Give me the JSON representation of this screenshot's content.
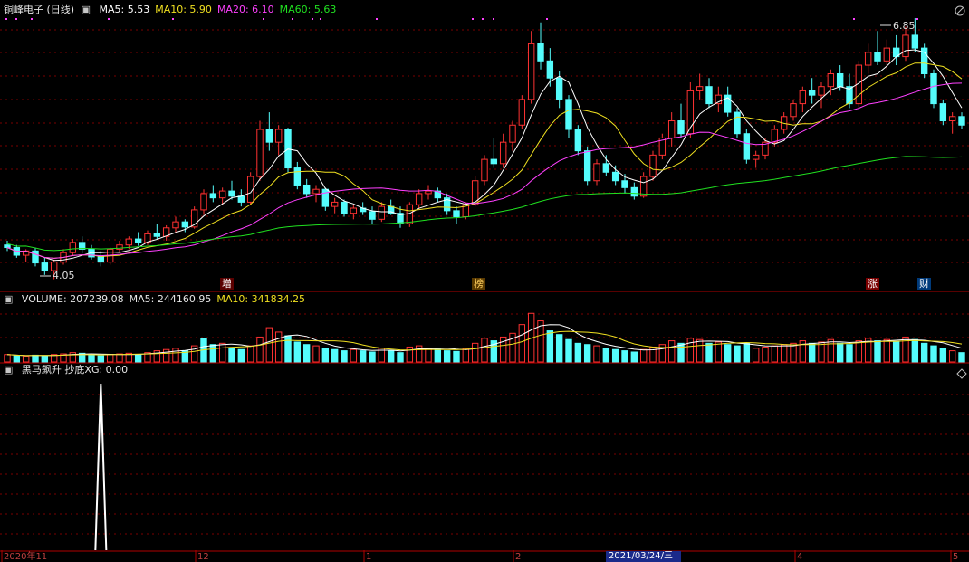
{
  "app": {
    "title": "铜峰电子 (日线)"
  },
  "price_panel": {
    "ma_labels": [
      {
        "text": "MA5: 5.53",
        "color": "#ffffff"
      },
      {
        "text": "MA10: 5.90",
        "color": "#f0e020"
      },
      {
        "text": "MA20: 6.10",
        "color": "#ff40ff"
      },
      {
        "text": "MA60: 5.63",
        "color": "#20e020"
      }
    ],
    "high_label": "6.85",
    "low_label": "4.05",
    "markers": [
      {
        "text": "增",
        "bg": "#5a0000",
        "color": "#ffffff"
      },
      {
        "text": "榜",
        "bg": "#5a3a00",
        "color": "#ffd060"
      },
      {
        "text": "涨",
        "bg": "#7a0000",
        "color": "#ffffff"
      },
      {
        "text": "财",
        "bg": "#003a7a",
        "color": "#ffffff"
      }
    ]
  },
  "volume_panel": {
    "labels": [
      {
        "text": "VOLUME: 207239.08",
        "color": "#e6e6e6"
      },
      {
        "text": "MA5: 244160.95",
        "color": "#e6e6e6"
      },
      {
        "text": "MA10: 341834.25",
        "color": "#f0e020"
      }
    ]
  },
  "indicator_panel": {
    "label": "黑马飙升 抄底XG: 0.00"
  },
  "time_axis": {
    "labels": [
      "2020年11",
      "12",
      "1",
      "2",
      "3",
      "4",
      "5"
    ],
    "cursor_date": "2021/03/24/三"
  },
  "colors": {
    "up": "#ff3232",
    "down": "#54fcfc",
    "grid": "#7a0000",
    "panel_border": "#b00000",
    "ma5": "#ffffff",
    "ma10": "#f0e020",
    "ma20": "#ff40ff",
    "ma60": "#20e020"
  },
  "icons": [
    "window-close-icon",
    "minimize-icon",
    "maximize-icon"
  ],
  "chart_data": {
    "type": "candlestick",
    "price_range": [
      3.95,
      7.1
    ],
    "candles": [
      [
        4.45,
        4.5,
        4.38,
        4.42
      ],
      [
        4.42,
        4.45,
        4.3,
        4.33
      ],
      [
        4.33,
        4.4,
        4.25,
        4.38
      ],
      [
        4.38,
        4.42,
        4.2,
        4.24
      ],
      [
        4.24,
        4.3,
        4.1,
        4.15
      ],
      [
        4.15,
        4.28,
        4.05,
        4.25
      ],
      [
        4.25,
        4.4,
        4.22,
        4.36
      ],
      [
        4.36,
        4.52,
        4.32,
        4.48
      ],
      [
        4.48,
        4.55,
        4.35,
        4.4
      ],
      [
        4.4,
        4.45,
        4.28,
        4.31
      ],
      [
        4.31,
        4.38,
        4.2,
        4.25
      ],
      [
        4.25,
        4.42,
        4.22,
        4.4
      ],
      [
        4.4,
        4.5,
        4.36,
        4.45
      ],
      [
        4.45,
        4.55,
        4.4,
        4.52
      ],
      [
        4.52,
        4.6,
        4.44,
        4.48
      ],
      [
        4.48,
        4.62,
        4.45,
        4.58
      ],
      [
        4.58,
        4.7,
        4.52,
        4.55
      ],
      [
        4.55,
        4.68,
        4.5,
        4.65
      ],
      [
        4.65,
        4.78,
        4.6,
        4.72
      ],
      [
        4.72,
        4.75,
        4.6,
        4.66
      ],
      [
        4.66,
        4.9,
        4.64,
        4.86
      ],
      [
        4.86,
        5.1,
        4.8,
        5.05
      ],
      [
        5.05,
        5.15,
        4.95,
        5.0
      ],
      [
        5.0,
        5.12,
        4.92,
        5.08
      ],
      [
        5.08,
        5.2,
        4.98,
        5.02
      ],
      [
        5.02,
        5.1,
        4.9,
        4.95
      ],
      [
        4.95,
        5.3,
        4.92,
        5.25
      ],
      [
        5.25,
        5.9,
        5.2,
        5.8
      ],
      [
        5.8,
        6.0,
        5.55,
        5.65
      ],
      [
        5.65,
        5.85,
        5.5,
        5.8
      ],
      [
        5.8,
        5.82,
        5.3,
        5.35
      ],
      [
        5.35,
        5.42,
        5.1,
        5.15
      ],
      [
        5.15,
        5.22,
        5.0,
        5.05
      ],
      [
        5.05,
        5.15,
        4.95,
        5.1
      ],
      [
        5.1,
        5.12,
        4.85,
        4.9
      ],
      [
        4.9,
        5.0,
        4.82,
        4.95
      ],
      [
        4.95,
        4.98,
        4.78,
        4.82
      ],
      [
        4.82,
        4.92,
        4.75,
        4.88
      ],
      [
        4.88,
        4.95,
        4.8,
        4.84
      ],
      [
        4.84,
        4.9,
        4.7,
        4.75
      ],
      [
        4.75,
        4.95,
        4.72,
        4.9
      ],
      [
        4.9,
        4.98,
        4.8,
        4.82
      ],
      [
        4.82,
        4.9,
        4.65,
        4.7
      ],
      [
        4.7,
        4.95,
        4.66,
        4.92
      ],
      [
        4.92,
        5.1,
        4.88,
        5.05
      ],
      [
        5.05,
        5.15,
        4.98,
        5.08
      ],
      [
        5.08,
        5.12,
        4.95,
        5.0
      ],
      [
        5.0,
        5.05,
        4.8,
        4.85
      ],
      [
        4.85,
        4.9,
        4.7,
        4.78
      ],
      [
        4.78,
        4.95,
        4.75,
        4.92
      ],
      [
        4.92,
        5.25,
        4.9,
        5.2
      ],
      [
        5.2,
        5.5,
        5.15,
        5.45
      ],
      [
        5.45,
        5.7,
        5.35,
        5.4
      ],
      [
        5.4,
        5.75,
        5.35,
        5.65
      ],
      [
        5.65,
        5.9,
        5.55,
        5.85
      ],
      [
        5.85,
        6.2,
        5.8,
        6.15
      ],
      [
        6.15,
        6.95,
        6.1,
        6.8
      ],
      [
        6.8,
        7.05,
        6.5,
        6.6
      ],
      [
        6.6,
        6.75,
        6.3,
        6.4
      ],
      [
        6.4,
        6.48,
        6.05,
        6.15
      ],
      [
        6.15,
        6.2,
        5.7,
        5.8
      ],
      [
        5.8,
        5.85,
        5.5,
        5.55
      ],
      [
        5.55,
        5.6,
        5.15,
        5.2
      ],
      [
        5.2,
        5.45,
        5.15,
        5.4
      ],
      [
        5.4,
        5.5,
        5.25,
        5.3
      ],
      [
        5.3,
        5.38,
        5.15,
        5.2
      ],
      [
        5.2,
        5.28,
        5.05,
        5.12
      ],
      [
        5.12,
        5.18,
        4.98,
        5.02
      ],
      [
        5.02,
        5.3,
        5.0,
        5.25
      ],
      [
        5.25,
        5.55,
        5.2,
        5.5
      ],
      [
        5.5,
        5.75,
        5.45,
        5.7
      ],
      [
        5.7,
        6.0,
        5.6,
        5.9
      ],
      [
        5.9,
        6.1,
        5.7,
        5.75
      ],
      [
        5.75,
        6.35,
        5.7,
        6.25
      ],
      [
        6.25,
        6.45,
        6.15,
        6.3
      ],
      [
        6.3,
        6.4,
        6.05,
        6.1
      ],
      [
        6.1,
        6.3,
        6.0,
        6.2
      ],
      [
        6.2,
        6.3,
        5.95,
        6.0
      ],
      [
        6.0,
        6.05,
        5.7,
        5.75
      ],
      [
        5.75,
        5.8,
        5.4,
        5.45
      ],
      [
        5.45,
        5.55,
        5.35,
        5.5
      ],
      [
        5.5,
        5.7,
        5.45,
        5.65
      ],
      [
        5.65,
        5.85,
        5.6,
        5.8
      ],
      [
        5.8,
        6.0,
        5.75,
        5.95
      ],
      [
        5.95,
        6.15,
        5.9,
        6.1
      ],
      [
        6.1,
        6.3,
        6.0,
        6.25
      ],
      [
        6.25,
        6.4,
        6.1,
        6.2
      ],
      [
        6.2,
        6.35,
        6.05,
        6.3
      ],
      [
        6.3,
        6.5,
        6.2,
        6.45
      ],
      [
        6.45,
        6.55,
        6.25,
        6.3
      ],
      [
        6.3,
        6.45,
        6.05,
        6.1
      ],
      [
        6.1,
        6.6,
        6.05,
        6.55
      ],
      [
        6.55,
        6.8,
        6.45,
        6.7
      ],
      [
        6.7,
        6.95,
        6.55,
        6.6
      ],
      [
        6.6,
        6.85,
        6.5,
        6.75
      ],
      [
        6.75,
        6.9,
        6.55,
        6.65
      ],
      [
        6.65,
        7.0,
        6.6,
        6.9
      ],
      [
        6.9,
        7.1,
        6.7,
        6.75
      ],
      [
        6.75,
        6.8,
        6.4,
        6.45
      ],
      [
        6.45,
        6.5,
        6.05,
        6.1
      ],
      [
        6.1,
        6.15,
        5.85,
        5.9
      ],
      [
        5.9,
        6.0,
        5.75,
        5.95
      ],
      [
        5.95,
        6.0,
        5.8,
        5.85
      ]
    ],
    "volume": [
      [
        12,
        1
      ],
      [
        10,
        0
      ],
      [
        9,
        1
      ],
      [
        11,
        0
      ],
      [
        10,
        0
      ],
      [
        12,
        1
      ],
      [
        13,
        1
      ],
      [
        15,
        1
      ],
      [
        14,
        0
      ],
      [
        11,
        0
      ],
      [
        10,
        0
      ],
      [
        12,
        1
      ],
      [
        13,
        1
      ],
      [
        14,
        1
      ],
      [
        12,
        0
      ],
      [
        15,
        1
      ],
      [
        18,
        1
      ],
      [
        20,
        1
      ],
      [
        22,
        1
      ],
      [
        18,
        0
      ],
      [
        26,
        1
      ],
      [
        38,
        0
      ],
      [
        28,
        0
      ],
      [
        30,
        1
      ],
      [
        22,
        0
      ],
      [
        20,
        0
      ],
      [
        26,
        1
      ],
      [
        40,
        1
      ],
      [
        55,
        1
      ],
      [
        48,
        1
      ],
      [
        42,
        0
      ],
      [
        32,
        0
      ],
      [
        28,
        0
      ],
      [
        26,
        1
      ],
      [
        22,
        0
      ],
      [
        20,
        0
      ],
      [
        18,
        0
      ],
      [
        20,
        1
      ],
      [
        18,
        0
      ],
      [
        16,
        0
      ],
      [
        22,
        1
      ],
      [
        18,
        0
      ],
      [
        15,
        0
      ],
      [
        24,
        1
      ],
      [
        26,
        1
      ],
      [
        22,
        1
      ],
      [
        20,
        0
      ],
      [
        18,
        0
      ],
      [
        17,
        0
      ],
      [
        22,
        1
      ],
      [
        30,
        1
      ],
      [
        38,
        1
      ],
      [
        34,
        0
      ],
      [
        40,
        1
      ],
      [
        46,
        1
      ],
      [
        60,
        1
      ],
      [
        78,
        1
      ],
      [
        66,
        1
      ],
      [
        50,
        0
      ],
      [
        44,
        0
      ],
      [
        36,
        0
      ],
      [
        30,
        0
      ],
      [
        28,
        0
      ],
      [
        26,
        1
      ],
      [
        22,
        0
      ],
      [
        20,
        0
      ],
      [
        18,
        0
      ],
      [
        16,
        0
      ],
      [
        20,
        1
      ],
      [
        24,
        1
      ],
      [
        28,
        1
      ],
      [
        34,
        1
      ],
      [
        30,
        0
      ],
      [
        38,
        1
      ],
      [
        36,
        1
      ],
      [
        30,
        0
      ],
      [
        32,
        1
      ],
      [
        28,
        0
      ],
      [
        26,
        0
      ],
      [
        30,
        0
      ],
      [
        22,
        1
      ],
      [
        24,
        1
      ],
      [
        26,
        1
      ],
      [
        28,
        1
      ],
      [
        30,
        1
      ],
      [
        34,
        1
      ],
      [
        30,
        0
      ],
      [
        32,
        1
      ],
      [
        36,
        1
      ],
      [
        30,
        0
      ],
      [
        28,
        0
      ],
      [
        34,
        1
      ],
      [
        38,
        1
      ],
      [
        34,
        0
      ],
      [
        36,
        1
      ],
      [
        32,
        0
      ],
      [
        40,
        1
      ],
      [
        36,
        0
      ],
      [
        30,
        0
      ],
      [
        26,
        0
      ],
      [
        22,
        0
      ],
      [
        18,
        1
      ],
      [
        15,
        0
      ]
    ],
    "volume_range": [
      0,
      90
    ],
    "indicator": {
      "peak_index": 10,
      "value": 0.0
    }
  }
}
